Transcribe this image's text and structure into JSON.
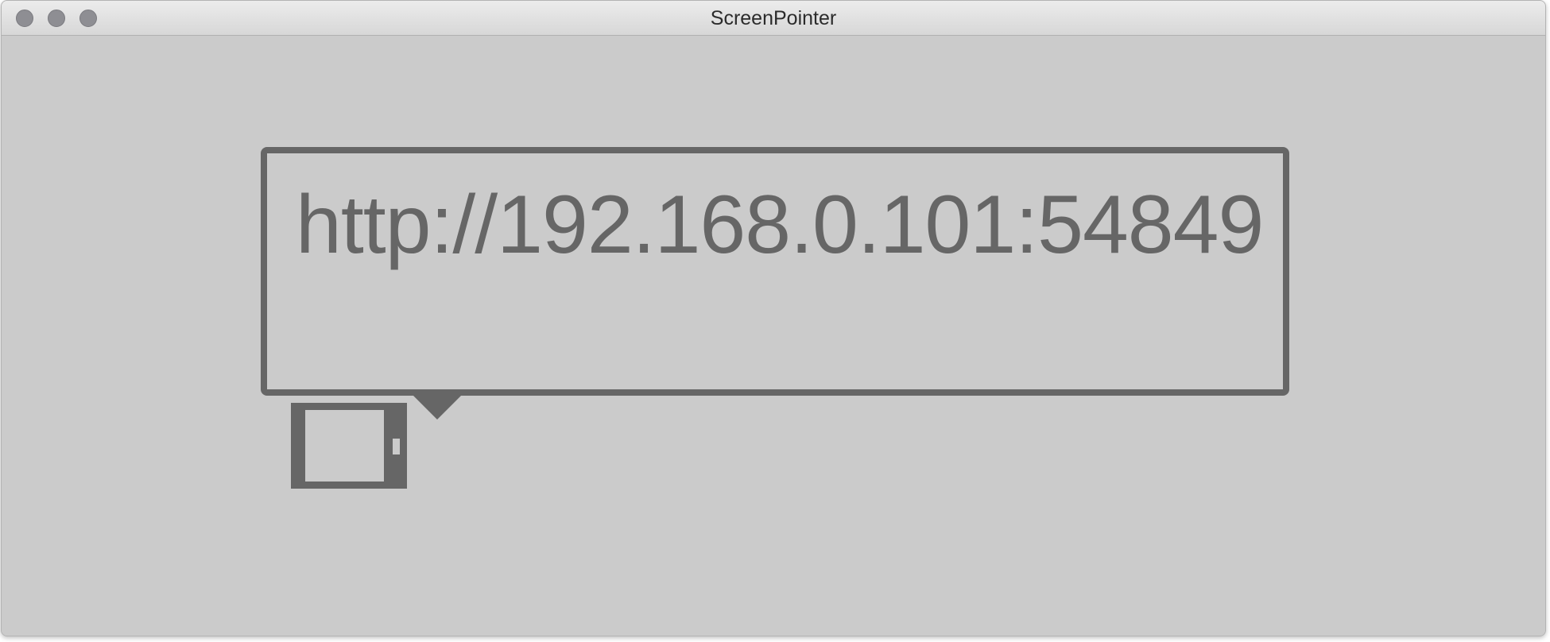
{
  "window": {
    "title": "ScreenPointer",
    "controls": [
      "close-button",
      "minimize-button",
      "zoom-button"
    ]
  },
  "main": {
    "url_text": "http://192.168.0.101:54849",
    "device_icon": "tablet-icon",
    "pointer_icon": "callout-pointer-icon"
  },
  "colors": {
    "background": "#cbcbcb",
    "foreground": "#666666",
    "traffic_light": "#8e8e93"
  }
}
